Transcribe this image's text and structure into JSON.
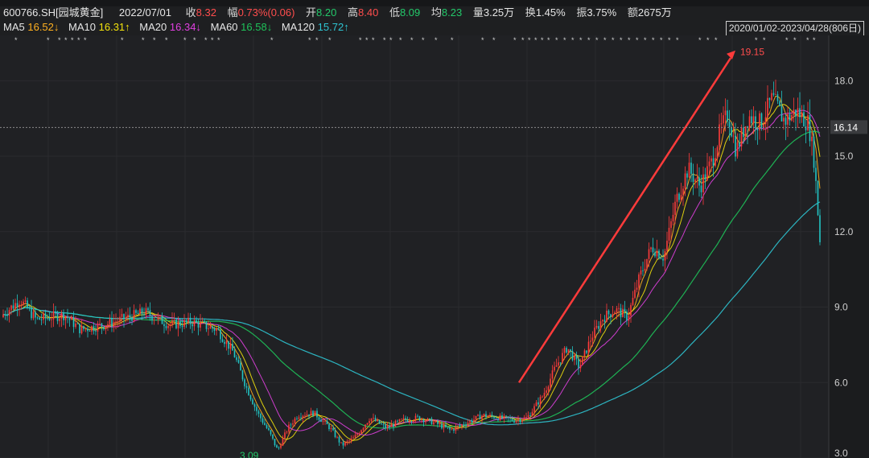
{
  "header": {
    "code": "600766.SH[园城黄金]",
    "date": "2022/07/01",
    "close_label": "收",
    "close": "8.32",
    "change_label": "幅",
    "change": "0.73%(0.06)",
    "open_label": "开",
    "open": "8.20",
    "high_label": "高",
    "high": "8.40",
    "low_label": "低",
    "low": "8.09",
    "avg_label": "均",
    "avg": "8.23",
    "vol_label": "量",
    "vol": "3.25万",
    "turnover_label": "换",
    "turnover": "1.45%",
    "amp_label": "振",
    "amp": "3.75%",
    "amount_label": "额",
    "amount": "2675万"
  },
  "ma": [
    {
      "name": "MA5",
      "value": "16.52↓",
      "color": "#ffb020"
    },
    {
      "name": "MA10",
      "value": "16.31↑",
      "color": "#f2e20c"
    },
    {
      "name": "MA20",
      "value": "16.34↓",
      "color": "#e040e0"
    },
    {
      "name": "MA60",
      "value": "16.58↓",
      "color": "#1ec25a"
    },
    {
      "name": "MA120",
      "value": "15.72↑",
      "color": "#2ec4d2"
    }
  ],
  "range_text": "2020/01/02-2023/04/28(806日)",
  "chart_data": {
    "type": "candlestick",
    "ylim": [
      3.0,
      19.8
    ],
    "y_ticks": [
      "18.0",
      "15.0",
      "12.0",
      "9.0",
      "6.0",
      "3.0"
    ],
    "current_price": "16.14",
    "max_label": "19.15",
    "min_label": "3.09",
    "price_path": [
      [
        0,
        8.6
      ],
      [
        25,
        9.3
      ],
      [
        45,
        8.5
      ],
      [
        80,
        8.7
      ],
      [
        100,
        8.1
      ],
      [
        130,
        8.3
      ],
      [
        160,
        8.6
      ],
      [
        180,
        8.8
      ],
      [
        210,
        8.3
      ],
      [
        240,
        8.4
      ],
      [
        270,
        8.1
      ],
      [
        290,
        7.2
      ],
      [
        305,
        5.9
      ],
      [
        320,
        4.8
      ],
      [
        335,
        4.0
      ],
      [
        345,
        3.3
      ],
      [
        358,
        4.2
      ],
      [
        370,
        4.7
      ],
      [
        390,
        4.8
      ],
      [
        410,
        4.2
      ],
      [
        425,
        3.5
      ],
      [
        440,
        3.8
      ],
      [
        460,
        4.6
      ],
      [
        480,
        4.2
      ],
      [
        500,
        4.5
      ],
      [
        520,
        4.6
      ],
      [
        540,
        4.4
      ],
      [
        560,
        4.1
      ],
      [
        580,
        4.4
      ],
      [
        600,
        4.7
      ],
      [
        620,
        4.6
      ],
      [
        640,
        4.5
      ],
      [
        655,
        4.6
      ],
      [
        675,
        5.5
      ],
      [
        690,
        6.6
      ],
      [
        705,
        7.4
      ],
      [
        720,
        6.6
      ],
      [
        735,
        7.8
      ],
      [
        750,
        8.6
      ],
      [
        765,
        8.9
      ],
      [
        780,
        8.6
      ],
      [
        795,
        10.2
      ],
      [
        810,
        11.4
      ],
      [
        825,
        11.0
      ],
      [
        840,
        13.2
      ],
      [
        855,
        14.5
      ],
      [
        870,
        13.8
      ],
      [
        885,
        14.8
      ],
      [
        895,
        16.0
      ],
      [
        905,
        16.7
      ],
      [
        915,
        15.2
      ],
      [
        930,
        16.6
      ],
      [
        945,
        16.3
      ],
      [
        960,
        17.3
      ],
      [
        975,
        16.4
      ],
      [
        990,
        16.8
      ],
      [
        1005,
        16.3
      ],
      [
        1012,
        14.8
      ],
      [
        1020,
        11.2
      ]
    ]
  }
}
